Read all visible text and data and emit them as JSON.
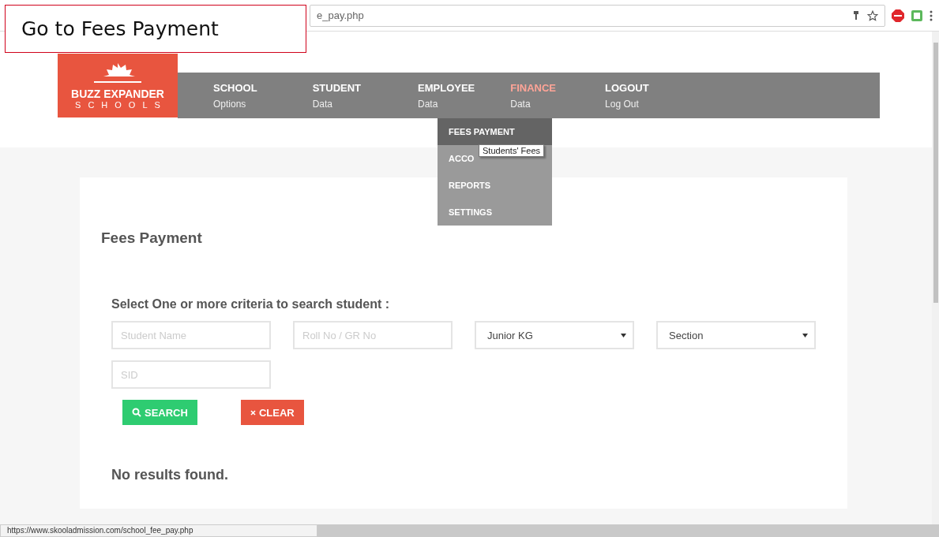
{
  "callout": {
    "text": "Go to Fees Payment"
  },
  "browser": {
    "address": "e_pay.php",
    "status_url": "https://www.skooladmission.com/school_fee_pay.php"
  },
  "logo": {
    "title": "BUZZ EXPANDER",
    "subtitle": "SCHOOLS"
  },
  "nav": [
    {
      "label": "SCHOOL",
      "sub": "Options",
      "selected": false
    },
    {
      "label": "STUDENT",
      "sub": "Data",
      "selected": false
    },
    {
      "label": "EMPLOYEE",
      "sub": "Data",
      "selected": false
    },
    {
      "label": "FINANCE",
      "sub": "Data",
      "selected": true
    },
    {
      "label": "LOGOUT",
      "sub": "Log Out",
      "selected": false
    }
  ],
  "dropdown": [
    {
      "label": "FEES PAYMENT",
      "selected": true
    },
    {
      "label": "ACCO",
      "selected": false
    },
    {
      "label": "REPORTS",
      "selected": false
    },
    {
      "label": "SETTINGS",
      "selected": false
    }
  ],
  "tooltip": "Students' Fees",
  "page_title": "Fees Payment",
  "criteria_label": "Select One or more criteria to search student :",
  "fields": [
    {
      "kind": "input",
      "placeholder": "Student Name"
    },
    {
      "kind": "input",
      "placeholder": "Roll No / GR No"
    },
    {
      "kind": "select",
      "value": "Junior KG"
    },
    {
      "kind": "select",
      "value": "Section"
    },
    {
      "kind": "input",
      "placeholder": "SID"
    }
  ],
  "buttons": [
    {
      "kind": "search",
      "label": "SEARCH"
    },
    {
      "kind": "clear",
      "label": "CLEAR"
    }
  ],
  "result": "No results found."
}
